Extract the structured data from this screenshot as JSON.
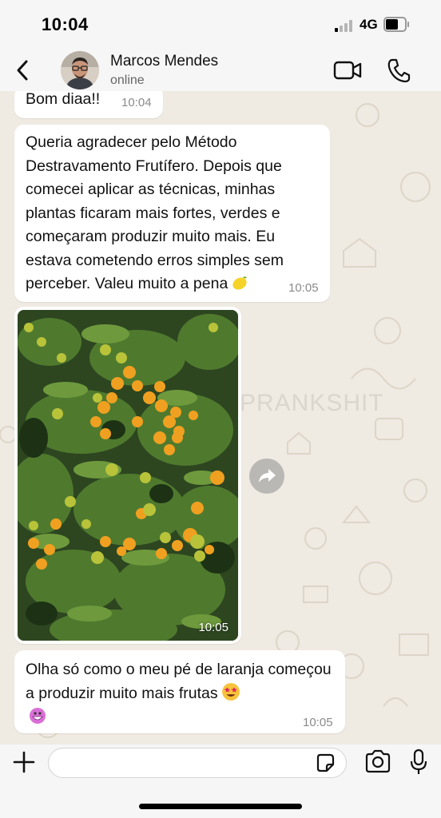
{
  "status_bar": {
    "time": "10:04",
    "network": "4G",
    "battery_level": 0.55,
    "signal_bars": 1
  },
  "header": {
    "contact_name": "Marcos Mendes",
    "contact_status": "online",
    "icons": [
      "back-icon",
      "video-call-icon",
      "phone-icon"
    ]
  },
  "watermark": "PRANKSHIT",
  "messages": [
    {
      "text": "Bom diaa!!",
      "time": "10:04"
    },
    {
      "text": "Queria agradecer pelo Método Destravamento Frutífero. Depois que comecei aplicar as técnicas, minhas plantas ficaram mais fortes, verdes e começaram produzir muito mais. Eu estava cometendo erros simples sem perceber. Valeu muito a pena",
      "emoji": "lemon",
      "time": "10:05"
    },
    {
      "type": "image",
      "subject": "orange tree",
      "time": "10:05"
    },
    {
      "text": "Olha só como o meu pé de laranja começou a produzir muito mais frutas",
      "emoji": "star-struck, grinning",
      "time": "10:05"
    }
  ],
  "input_bar": {
    "placeholder": "",
    "icons": [
      "plus-icon",
      "sticker-icon",
      "camera-icon",
      "mic-icon"
    ]
  },
  "colors": {
    "chat_background": "#efeae2",
    "bubble": "#ffffff",
    "bars": "#f6f6f6"
  }
}
